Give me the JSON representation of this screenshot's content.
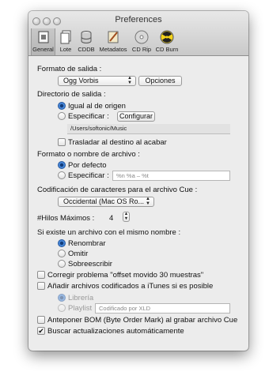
{
  "window": {
    "title": "Preferences"
  },
  "toolbar": {
    "items": [
      {
        "label": "General",
        "icon": "general-icon",
        "selected": true
      },
      {
        "label": "Lote",
        "icon": "batch-icon"
      },
      {
        "label": "CDDB",
        "icon": "database-icon"
      },
      {
        "label": "Metadatos",
        "icon": "metadata-icon"
      },
      {
        "label": "CD Rip",
        "icon": "cd-icon"
      },
      {
        "label": "CD Burn",
        "icon": "burn-icon"
      }
    ]
  },
  "output_format": {
    "heading": "Formato de salida :",
    "selected": "Ogg Vorbis",
    "options_button": "Opciones"
  },
  "output_dir": {
    "heading": "Directorio de salida :",
    "same_as_source": "Igual al de origen",
    "specify": "Especificar :",
    "configure_button": "Configurar",
    "path": "/Users/softonic/Music",
    "move_after": "Trasladar al destino al acabar"
  },
  "filename": {
    "heading": "Formato o nombre de archivo :",
    "default": "Por defecto",
    "specify": "Especificar :",
    "placeholder": "%n %a – %t"
  },
  "cue_encoding": {
    "heading": "Codificación de caracteres para el archivo Cue :",
    "selected": "Occidental (Mac OS Ro..."
  },
  "threads": {
    "label": "#Hilos Máximos :",
    "value": "4"
  },
  "existing_file": {
    "heading": "Si existe un archivo con el mismo nombre :",
    "options": [
      "Renombrar",
      "Omitir",
      "Sobreescribir"
    ]
  },
  "checks": {
    "offset_fix": "Corregir problema \"offset movido 30 muestras\"",
    "itunes": "Añadir archivos codificados a iTunes si es posible",
    "library": "Librería",
    "playlist": "Playlist",
    "playlist_placeholder": "Codificado por XLD",
    "bom": "Anteponer BOM (Byte Order Mark) al grabar archivo Cue",
    "updates": "Buscar actualizaciones automáticamente"
  },
  "colors": {
    "accent": "#2f6fc9",
    "window_bg": "#ececec"
  }
}
